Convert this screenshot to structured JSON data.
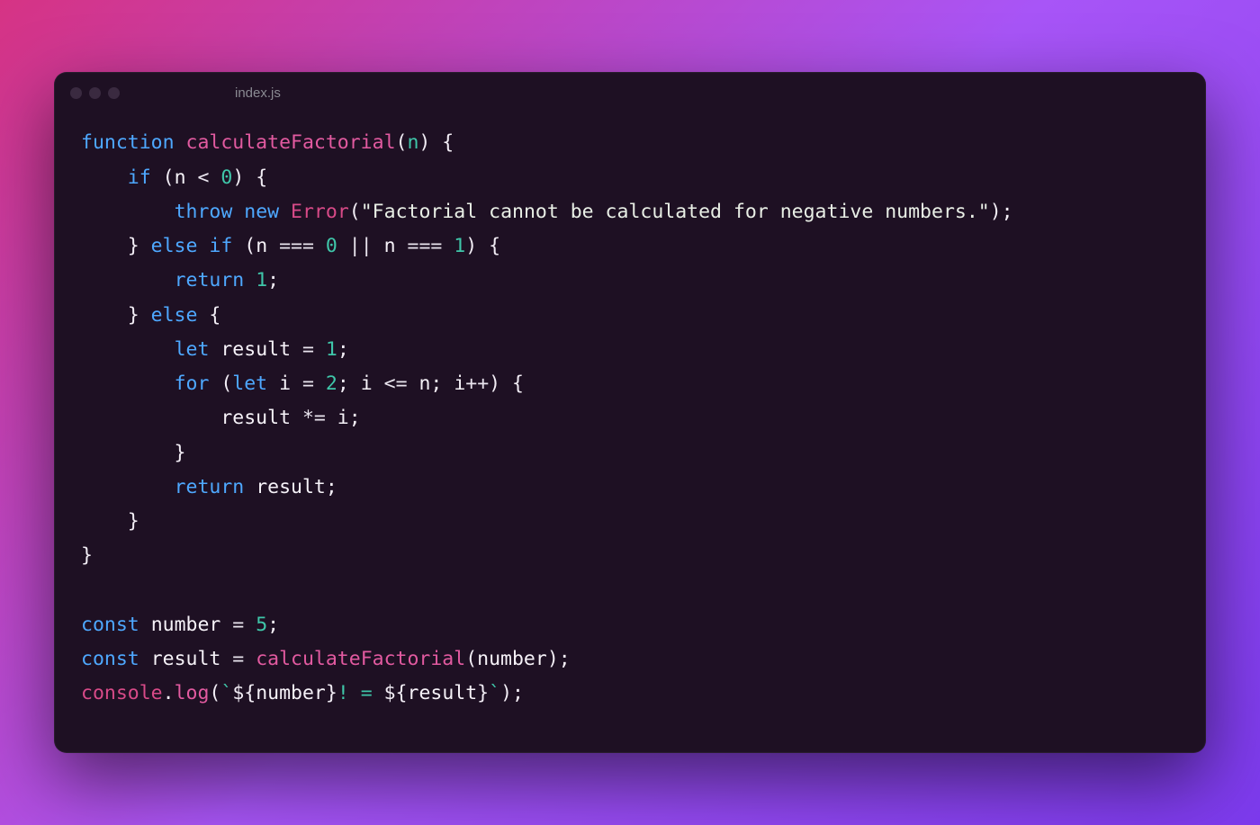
{
  "filename": "index.js",
  "theme": {
    "bg": "#1e1023",
    "keyword": "#4ea8ff",
    "function": "#e25aa0",
    "class": "#d84a88",
    "param": "#3fc6a9",
    "number": "#3fc6a9",
    "string": "#e9efe6",
    "default": "#f2edf5"
  },
  "code": {
    "lines": [
      [
        {
          "t": "function",
          "c": "kw"
        },
        {
          "t": " "
        },
        {
          "t": "calculateFactorial",
          "c": "fn"
        },
        {
          "t": "(",
          "c": "punc"
        },
        {
          "t": "n",
          "c": "param"
        },
        {
          "t": ") {",
          "c": "punc"
        }
      ],
      [
        {
          "t": "    "
        },
        {
          "t": "if",
          "c": "kw"
        },
        {
          "t": " (",
          "c": "punc"
        },
        {
          "t": "n",
          "c": "var"
        },
        {
          "t": " < ",
          "c": "op"
        },
        {
          "t": "0",
          "c": "num"
        },
        {
          "t": ") {",
          "c": "punc"
        }
      ],
      [
        {
          "t": "        "
        },
        {
          "t": "throw",
          "c": "kw"
        },
        {
          "t": " "
        },
        {
          "t": "new",
          "c": "kw"
        },
        {
          "t": " "
        },
        {
          "t": "Error",
          "c": "cls"
        },
        {
          "t": "(",
          "c": "punc"
        },
        {
          "t": "\"Factorial cannot be calculated for negative numbers.\"",
          "c": "str"
        },
        {
          "t": ");",
          "c": "punc"
        }
      ],
      [
        {
          "t": "    } "
        },
        {
          "t": "else",
          "c": "kw"
        },
        {
          "t": " "
        },
        {
          "t": "if",
          "c": "kw"
        },
        {
          "t": " (",
          "c": "punc"
        },
        {
          "t": "n",
          "c": "var"
        },
        {
          "t": " === ",
          "c": "op"
        },
        {
          "t": "0",
          "c": "num"
        },
        {
          "t": " || ",
          "c": "op"
        },
        {
          "t": "n",
          "c": "var"
        },
        {
          "t": " === ",
          "c": "op"
        },
        {
          "t": "1",
          "c": "num"
        },
        {
          "t": ") {",
          "c": "punc"
        }
      ],
      [
        {
          "t": "        "
        },
        {
          "t": "return",
          "c": "kw"
        },
        {
          "t": " "
        },
        {
          "t": "1",
          "c": "num"
        },
        {
          "t": ";",
          "c": "punc"
        }
      ],
      [
        {
          "t": "    } "
        },
        {
          "t": "else",
          "c": "kw"
        },
        {
          "t": " {",
          "c": "punc"
        }
      ],
      [
        {
          "t": "        "
        },
        {
          "t": "let",
          "c": "kw"
        },
        {
          "t": " "
        },
        {
          "t": "result",
          "c": "var"
        },
        {
          "t": " = ",
          "c": "op"
        },
        {
          "t": "1",
          "c": "num"
        },
        {
          "t": ";",
          "c": "punc"
        }
      ],
      [
        {
          "t": "        "
        },
        {
          "t": "for",
          "c": "kw"
        },
        {
          "t": " (",
          "c": "punc"
        },
        {
          "t": "let",
          "c": "kw"
        },
        {
          "t": " "
        },
        {
          "t": "i",
          "c": "var"
        },
        {
          "t": " = ",
          "c": "op"
        },
        {
          "t": "2",
          "c": "num"
        },
        {
          "t": "; ",
          "c": "punc"
        },
        {
          "t": "i",
          "c": "var"
        },
        {
          "t": " <= ",
          "c": "op"
        },
        {
          "t": "n",
          "c": "var"
        },
        {
          "t": "; ",
          "c": "punc"
        },
        {
          "t": "i",
          "c": "var"
        },
        {
          "t": "++",
          "c": "op"
        },
        {
          "t": ") {",
          "c": "punc"
        }
      ],
      [
        {
          "t": "            "
        },
        {
          "t": "result",
          "c": "var"
        },
        {
          "t": " *= ",
          "c": "op"
        },
        {
          "t": "i",
          "c": "var"
        },
        {
          "t": ";",
          "c": "punc"
        }
      ],
      [
        {
          "t": "        }",
          "c": "punc"
        }
      ],
      [
        {
          "t": "        "
        },
        {
          "t": "return",
          "c": "kw"
        },
        {
          "t": " "
        },
        {
          "t": "result",
          "c": "var"
        },
        {
          "t": ";",
          "c": "punc"
        }
      ],
      [
        {
          "t": "    }",
          "c": "punc"
        }
      ],
      [
        {
          "t": "}",
          "c": "punc"
        }
      ],
      [
        {
          "t": ""
        }
      ],
      [
        {
          "t": "const",
          "c": "kw"
        },
        {
          "t": " "
        },
        {
          "t": "number",
          "c": "var"
        },
        {
          "t": " = ",
          "c": "op"
        },
        {
          "t": "5",
          "c": "num"
        },
        {
          "t": ";",
          "c": "punc"
        }
      ],
      [
        {
          "t": "const",
          "c": "kw"
        },
        {
          "t": " "
        },
        {
          "t": "result",
          "c": "var"
        },
        {
          "t": " = ",
          "c": "op"
        },
        {
          "t": "calculateFactorial",
          "c": "fn"
        },
        {
          "t": "(",
          "c": "punc"
        },
        {
          "t": "number",
          "c": "var"
        },
        {
          "t": ");",
          "c": "punc"
        }
      ],
      [
        {
          "t": "console",
          "c": "cls"
        },
        {
          "t": ".",
          "c": "punc"
        },
        {
          "t": "log",
          "c": "prop"
        },
        {
          "t": "(",
          "c": "punc"
        },
        {
          "t": "`",
          "c": "tstr"
        },
        {
          "t": "${",
          "c": "punc"
        },
        {
          "t": "number",
          "c": "interp"
        },
        {
          "t": "}",
          "c": "punc"
        },
        {
          "t": "! = ",
          "c": "tstr"
        },
        {
          "t": "${",
          "c": "punc"
        },
        {
          "t": "result",
          "c": "interp"
        },
        {
          "t": "}",
          "c": "punc"
        },
        {
          "t": "`",
          "c": "tstr"
        },
        {
          "t": ");",
          "c": "punc"
        }
      ]
    ]
  }
}
